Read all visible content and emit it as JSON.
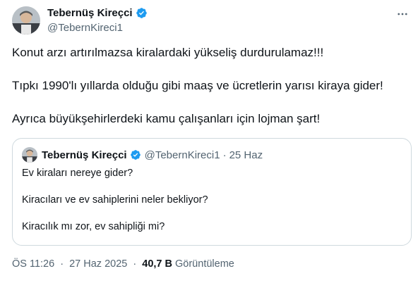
{
  "author": {
    "display_name": "Tebernüş Kireçci",
    "handle": "@TebernKireci1",
    "verified_icon": "verified-badge-icon",
    "verified_color": "#1d9bf0"
  },
  "tweet": {
    "paragraphs": [
      "Konut arzı artırılmazsa kiralardaki yükseliş durdurulamaz!!!",
      "Tıpkı 1990'lı yıllarda olduğu gibi maaş ve ücretlerin yarısı kiraya gider!",
      "Ayrıca büyükşehirlerdeki kamu çalışanları için lojman şart!"
    ]
  },
  "quote": {
    "display_name": "Tebernüş Kireçci",
    "handle": "@TebernKireci1",
    "separator": "·",
    "date": "25 Haz",
    "paragraphs": [
      "Ev kiraları nereye gider?",
      "Kiracıları ve ev sahiplerini neler bekliyor?",
      "Kiracılık mı zor, ev sahipliği mi?"
    ]
  },
  "meta": {
    "time": "ÖS 11:26",
    "date": "27 Haz 2025",
    "separator": "·",
    "views_count": "40,7 B",
    "views_label": "Görüntüleme"
  },
  "colors": {
    "text": "#0f1419",
    "secondary": "#536471",
    "border": "#cfd9de"
  }
}
